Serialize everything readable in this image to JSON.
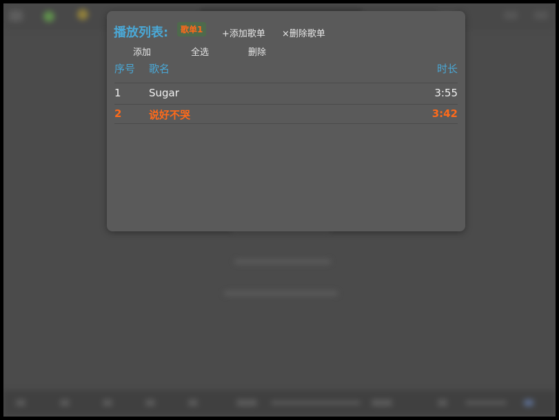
{
  "panel": {
    "title": "播放列表:",
    "playlist_tab": "歌单1",
    "add_playlist": "+添加歌单",
    "delete_playlist": "×删除歌单",
    "actions": [
      "添加",
      "全选",
      "删除"
    ]
  },
  "table": {
    "headers": {
      "index": "序号",
      "name": "歌名",
      "duration": "时长"
    },
    "rows": [
      {
        "index": "1",
        "name": "Sugar",
        "duration": "3:55",
        "state": "normal"
      },
      {
        "index": "2",
        "name": "说好不哭",
        "duration": "3:42",
        "state": "active"
      }
    ]
  },
  "colors": {
    "accent": "#4aa8d6",
    "active": "#ff6a1a",
    "panel_bg": "#5a5a5a"
  }
}
